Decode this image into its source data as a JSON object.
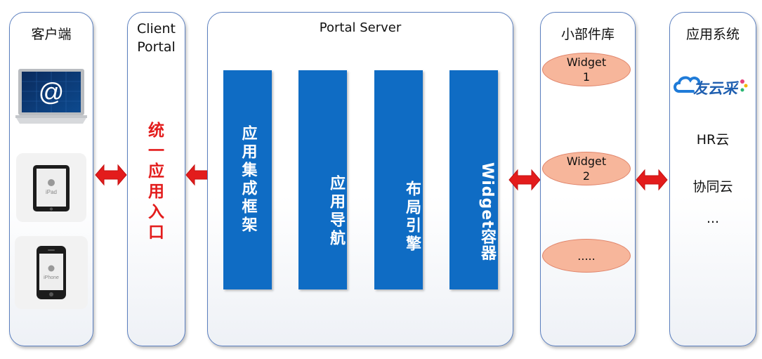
{
  "panels": {
    "client": "客户端",
    "portal_line1": "Client",
    "portal_line2": "Portal",
    "server": "Portal Server",
    "widget_lib": "小部件库",
    "app_system": "应用系统"
  },
  "devices": {
    "ipad_label": "iPad",
    "iphone_label": "iPhone",
    "laptop_symbol": "@"
  },
  "portal_vertical": [
    "统",
    "一",
    "应",
    "用",
    "入",
    "口"
  ],
  "server_bars": [
    "应用集成框架",
    "应用导航",
    "布局引擎",
    "Widget容器"
  ],
  "widgets": [
    {
      "line1": "Widget",
      "line2": "1"
    },
    {
      "line1": "Widget",
      "line2": "2"
    },
    {
      "line1": ".....",
      "line2": ""
    }
  ],
  "systems": {
    "logo_text": "友云采",
    "items": [
      "HR云",
      "协同云",
      "..."
    ]
  },
  "colors": {
    "panel_border": "#5b7fbf",
    "bar_blue": "#0f6cc4",
    "arrow_red": "#e31c1c",
    "widget_fill": "#f7b69b"
  }
}
